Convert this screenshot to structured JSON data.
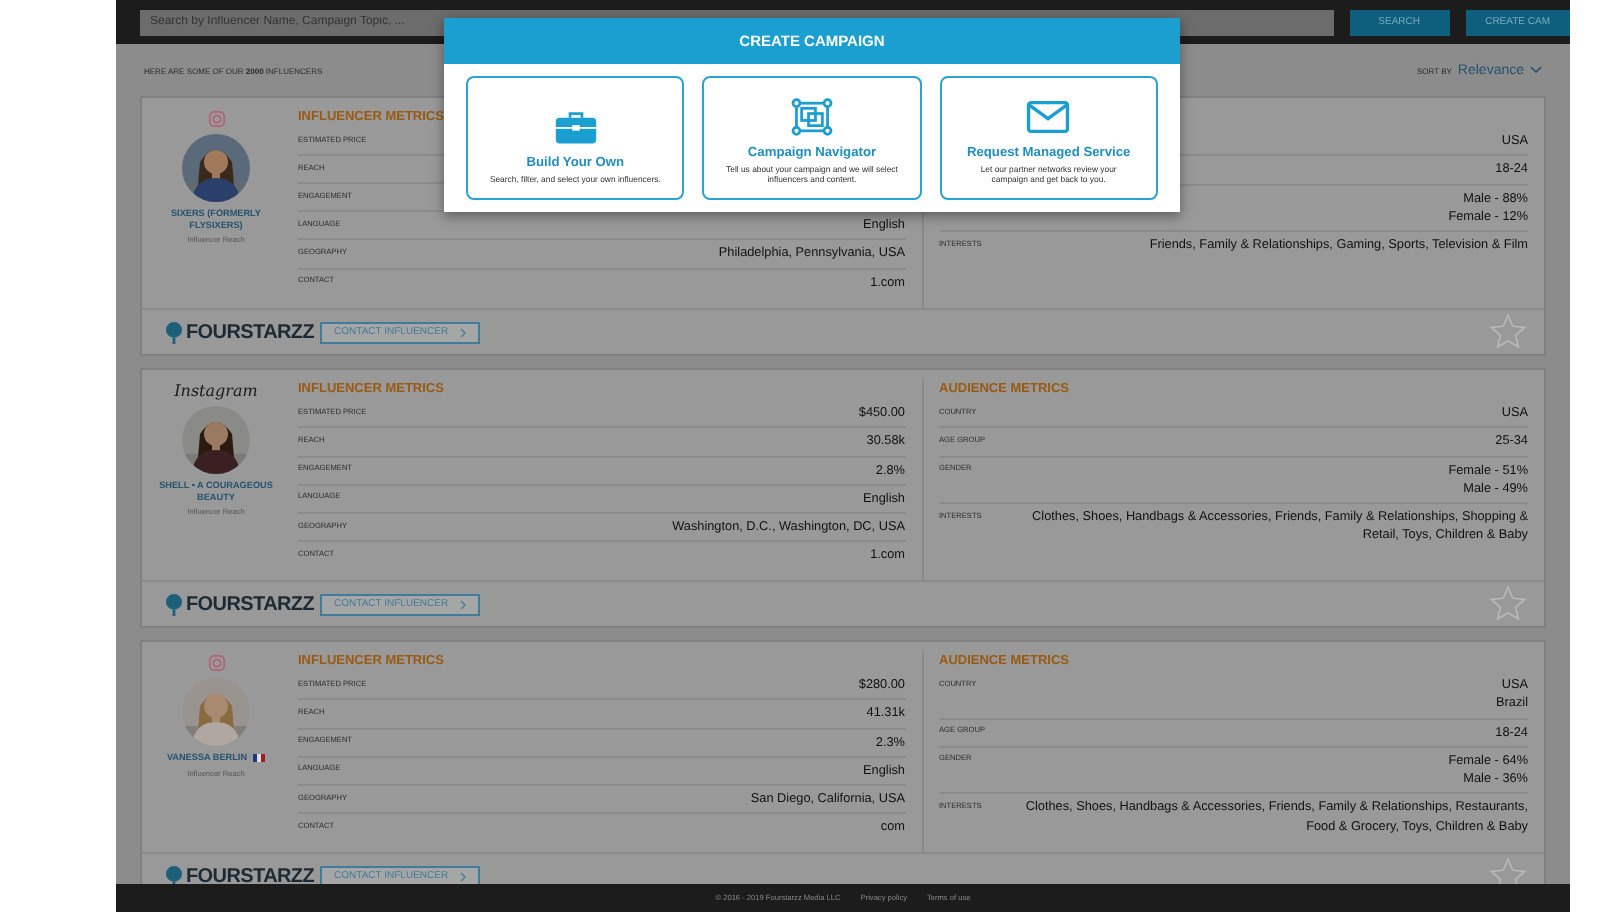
{
  "top_bar": {
    "search": {
      "placeholder": "Search by Influencer Name, Campaign Topic, ..."
    },
    "search_button": "SEARCH",
    "create_button": "CREATE CAM"
  },
  "results_note": "HERE ARE SOME OF OUR **2000** INFLUENCERS",
  "sort": {
    "label": "SORT BY",
    "value": "Relevance"
  },
  "cards": [
    {
      "platform": {
        "kind": "icon"
      },
      "name": "SIXERS (FORMERLY FLYSIXERS)",
      "flag": false,
      "reach_label": "Influencer Reach",
      "influencer_metrics": {
        "title": "INFLUENCER METRICS",
        "rows": [
          {
            "label": "ESTIMATED PRICE",
            "value": []
          },
          {
            "label": "REACH",
            "value": []
          },
          {
            "label": "ENGAGEMENT",
            "value": []
          },
          {
            "label": "LANGUAGE",
            "value": [
              "English"
            ]
          },
          {
            "label": "GEOGRAPHY",
            "value": [
              "Philadelphia, Pennsylvania, USA"
            ]
          },
          {
            "label": "CONTACT",
            "value": [
              "1.com"
            ]
          }
        ]
      },
      "audience_metrics": {
        "rows": [
          {
            "value": [
              "USA"
            ]
          },
          {
            "value": [
              "18-24"
            ]
          },
          {
            "value": [
              "Male - 88%",
              "Female - 12%"
            ]
          },
          {
            "label": "INTERESTS",
            "value": [
              "Friends, Family & Relationships, Gaming, Sports, Television & Film"
            ]
          }
        ]
      },
      "brand": "FOURSTARZZ",
      "contact_button": "CONTACT INFLUENCER",
      "favorite": false
    },
    {
      "platform": {
        "kind": "wordmark",
        "text": "Instagram"
      },
      "name": "SHELL • A COURAGEOUS BEAUTY",
      "flag": false,
      "reach_label": "Influencer Reach",
      "influencer_metrics": {
        "title": "INFLUENCER METRICS",
        "rows": [
          {
            "label": "ESTIMATED PRICE",
            "value": [
              "$450.00"
            ]
          },
          {
            "label": "REACH",
            "value": [
              "30.58k"
            ]
          },
          {
            "label": "ENGAGEMENT",
            "value": [
              "2.8%"
            ]
          },
          {
            "label": "LANGUAGE",
            "value": [
              "English"
            ]
          },
          {
            "label": "GEOGRAPHY",
            "value": [
              "Washington, D.C., Washington, DC, USA"
            ]
          },
          {
            "label": "CONTACT",
            "value": [
              "1.com"
            ]
          }
        ]
      },
      "audience_metrics": {
        "title": "AUDIENCE METRICS",
        "rows": [
          {
            "label": "COUNTRY",
            "value": [
              "USA"
            ]
          },
          {
            "label": "AGE GROUP",
            "value": [
              "25-34"
            ]
          },
          {
            "label": "GENDER",
            "value": [
              "Female - 51%",
              "Male - 49%"
            ]
          },
          {
            "label": "INTERESTS",
            "value": [
              "Clothes, Shoes, Handbags & Accessories, Friends, Family & Relationships, Shopping & Retail, Toys, Children & Baby"
            ]
          }
        ]
      },
      "brand": "FOURSTARZZ",
      "contact_button": "CONTACT INFLUENCER",
      "favorite": false
    },
    {
      "platform": {
        "kind": "icon"
      },
      "name": "VANESSA BERLIN",
      "flag": true,
      "reach_label": "Influencer Reach",
      "influencer_metrics": {
        "title": "INFLUENCER METRICS",
        "rows": [
          {
            "label": "ESTIMATED PRICE",
            "value": [
              "$280.00"
            ]
          },
          {
            "label": "REACH",
            "value": [
              "41.31k"
            ]
          },
          {
            "label": "ENGAGEMENT",
            "value": [
              "2.3%"
            ]
          },
          {
            "label": "LANGUAGE",
            "value": [
              "English"
            ]
          },
          {
            "label": "GEOGRAPHY",
            "value": [
              "San Diego, California, USA"
            ]
          },
          {
            "label": "CONTACT",
            "value": [
              "com"
            ]
          }
        ]
      },
      "audience_metrics": {
        "title": "AUDIENCE METRICS",
        "rows": [
          {
            "label": "COUNTRY",
            "value": [
              "USA",
              "Brazil"
            ]
          },
          {
            "label": "AGE GROUP",
            "value": [
              "18-24"
            ]
          },
          {
            "label": "GENDER",
            "value": [
              "Female - 64%",
              "Male - 36%"
            ]
          },
          {
            "label": "INTERESTS",
            "value": [
              "Clothes, Shoes, Handbags & Accessories, Friends, Family & Relationships, Restaurants, Food & Grocery, Toys, Children & Baby"
            ]
          }
        ]
      },
      "brand": "FOURSTARZZ",
      "contact_button": "CONTACT INFLUENCER",
      "favorite": false
    }
  ],
  "modal": {
    "title": "CREATE CAMPAIGN",
    "options": [
      {
        "kind": "briefcase",
        "title": "Build Your Own",
        "description": "Search, filter, and select your own influencers."
      },
      {
        "kind": "navigator",
        "title": "Campaign Navigator",
        "description": "Tell us about your campaign and we will select influencers and content."
      },
      {
        "kind": "envelope",
        "title": "Request Managed Service",
        "description": "Let our partner networks review your campaign and get back to you."
      }
    ]
  },
  "footer": {
    "copyright": "© 2016 - 2019 Fourstarzz Media LLC",
    "links": [
      "Privacy policy",
      "Terms of use"
    ]
  }
}
